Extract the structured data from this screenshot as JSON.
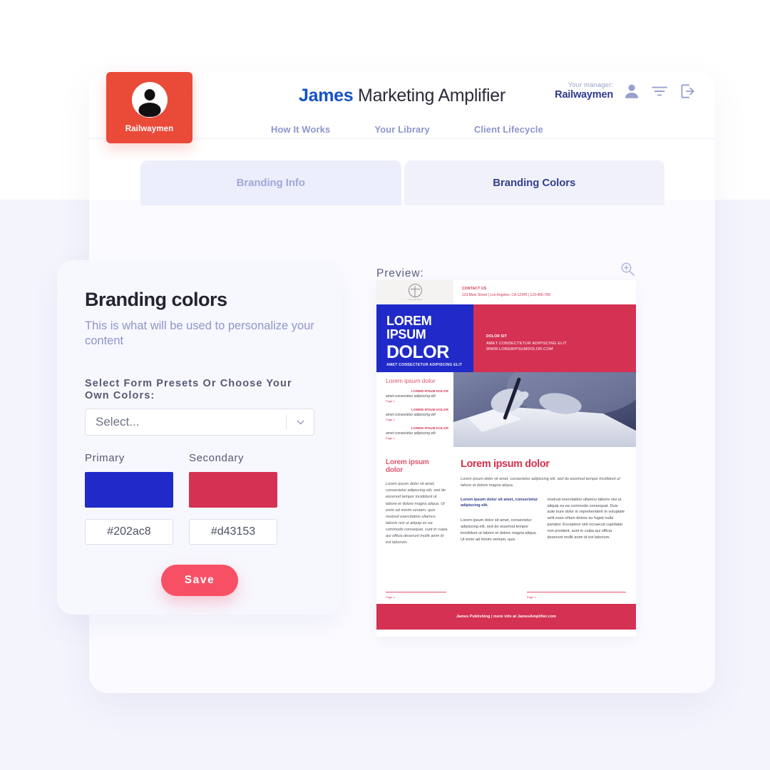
{
  "header": {
    "brand_bold": "James",
    "brand_rest": " Marketing Amplifier",
    "manager_label": "Your manager:",
    "manager_name": "Railwaymen"
  },
  "nav": {
    "items": [
      {
        "label": "How It Works"
      },
      {
        "label": "Your Library"
      },
      {
        "label": "Client Lifecycle"
      }
    ]
  },
  "badge": {
    "label": "Railwaymen"
  },
  "tabs": [
    {
      "label": "Branding Info",
      "active": false
    },
    {
      "label": "Branding Colors",
      "active": true
    }
  ],
  "form": {
    "title": "Branding colors",
    "subtitle": "This is what will be used to personalize your content",
    "select_label": "Select Form Presets Or Choose Your Own Colors:",
    "select_value": "Select...",
    "primary_label": "Primary",
    "primary_hex": "#202ac8",
    "secondary_label": "Secondary",
    "secondary_hex": "#d43153",
    "save_label": "Save"
  },
  "preview": {
    "label": "Preview:",
    "doc": {
      "logo_caption": "Your Law Firm",
      "contact_heading": "CONTACT US",
      "contact_text": "123 Main Street | Los Angeles, CA 12345 | 123-456-789",
      "hero_line1": "LOREM",
      "hero_line2": "IPSUM",
      "hero_line3": "DOLOR",
      "hero_sub": "AMET CONSECTETUR ADIPISCING ELIT",
      "hero_right_heading": "DOLOR SIT",
      "hero_right_line1": "AMET CONSECTETUR ADIPISCING ELIT",
      "hero_right_line2": "WWW.LOREMIPSUMDOLOR.COM",
      "toc_heading": "Lorem ipsum dolor",
      "toc_items": [
        {
          "heading": "LOREM IPSUM DOLOR",
          "text": "amet consectetur adipiscing elit",
          "page": "Page 1"
        },
        {
          "heading": "LOREM IPSUM DOLOR",
          "text": "amet consectetur adipiscing elit",
          "page": "Page 1"
        },
        {
          "heading": "LOREM IPSUM DOLOR",
          "text": "amet consectetur adipiscing elit",
          "page": "Page 1"
        }
      ],
      "article_left_heading": "Lorem ipsum dolor",
      "article_left_body": "Lorem ipsum dolor sit amet, consectetur adipiscing elit, sed do eiusmod tempor incididunt ut labore et dolore magna aliqua. Ut enim ad minim veniam, quis nostrud exercitation ullamco laboris nisi ut aliquip ex ea commodo consequat, sunt in culpa qui officia deserunt mollit anim id est laborum.",
      "article_left_page": "Page 1",
      "article_right_heading": "Lorem ipsum dolor",
      "article_right_lead": "Lorem ipsum dolor sit amet, consectetur adipiscing elit, sed do eiusmod tempor incididunt ut labore et dolore magna aliqua.",
      "article_right_bold": "Lorem ipsum dolor sit amet, consectetur adipiscing elit.",
      "article_right_col1": "Lorem ipsum dolor sit amet, consectetur adipiscing elit, sed do eiusmod tempor incididunt ut labore et dolore magna aliqua. Ut enim ad minim veniam, quis",
      "article_right_col2": "nostrud exercitation ullamco laboris nisi ut aliquip ex ea commodo consequat. Duis aute irure dolor in reprehenderit in voluptate velit esse cillum dolore eu fugiat nulla pariatur. Excepteur sint occaecat cupidatat non proident, sunt in culpa qui officia deserunt mollit anim id est laborum.",
      "article_right_page": "Page 1",
      "footer_text": "James Publishing | more info at JamesAmplifier.com"
    }
  },
  "colors": {
    "primary": "#202ac8",
    "secondary": "#d43153",
    "badge_red": "#ea4a38",
    "save_pink": "#f75064",
    "brand_blue": "#1452c8",
    "lavender_bg": "#f4f4fd"
  }
}
